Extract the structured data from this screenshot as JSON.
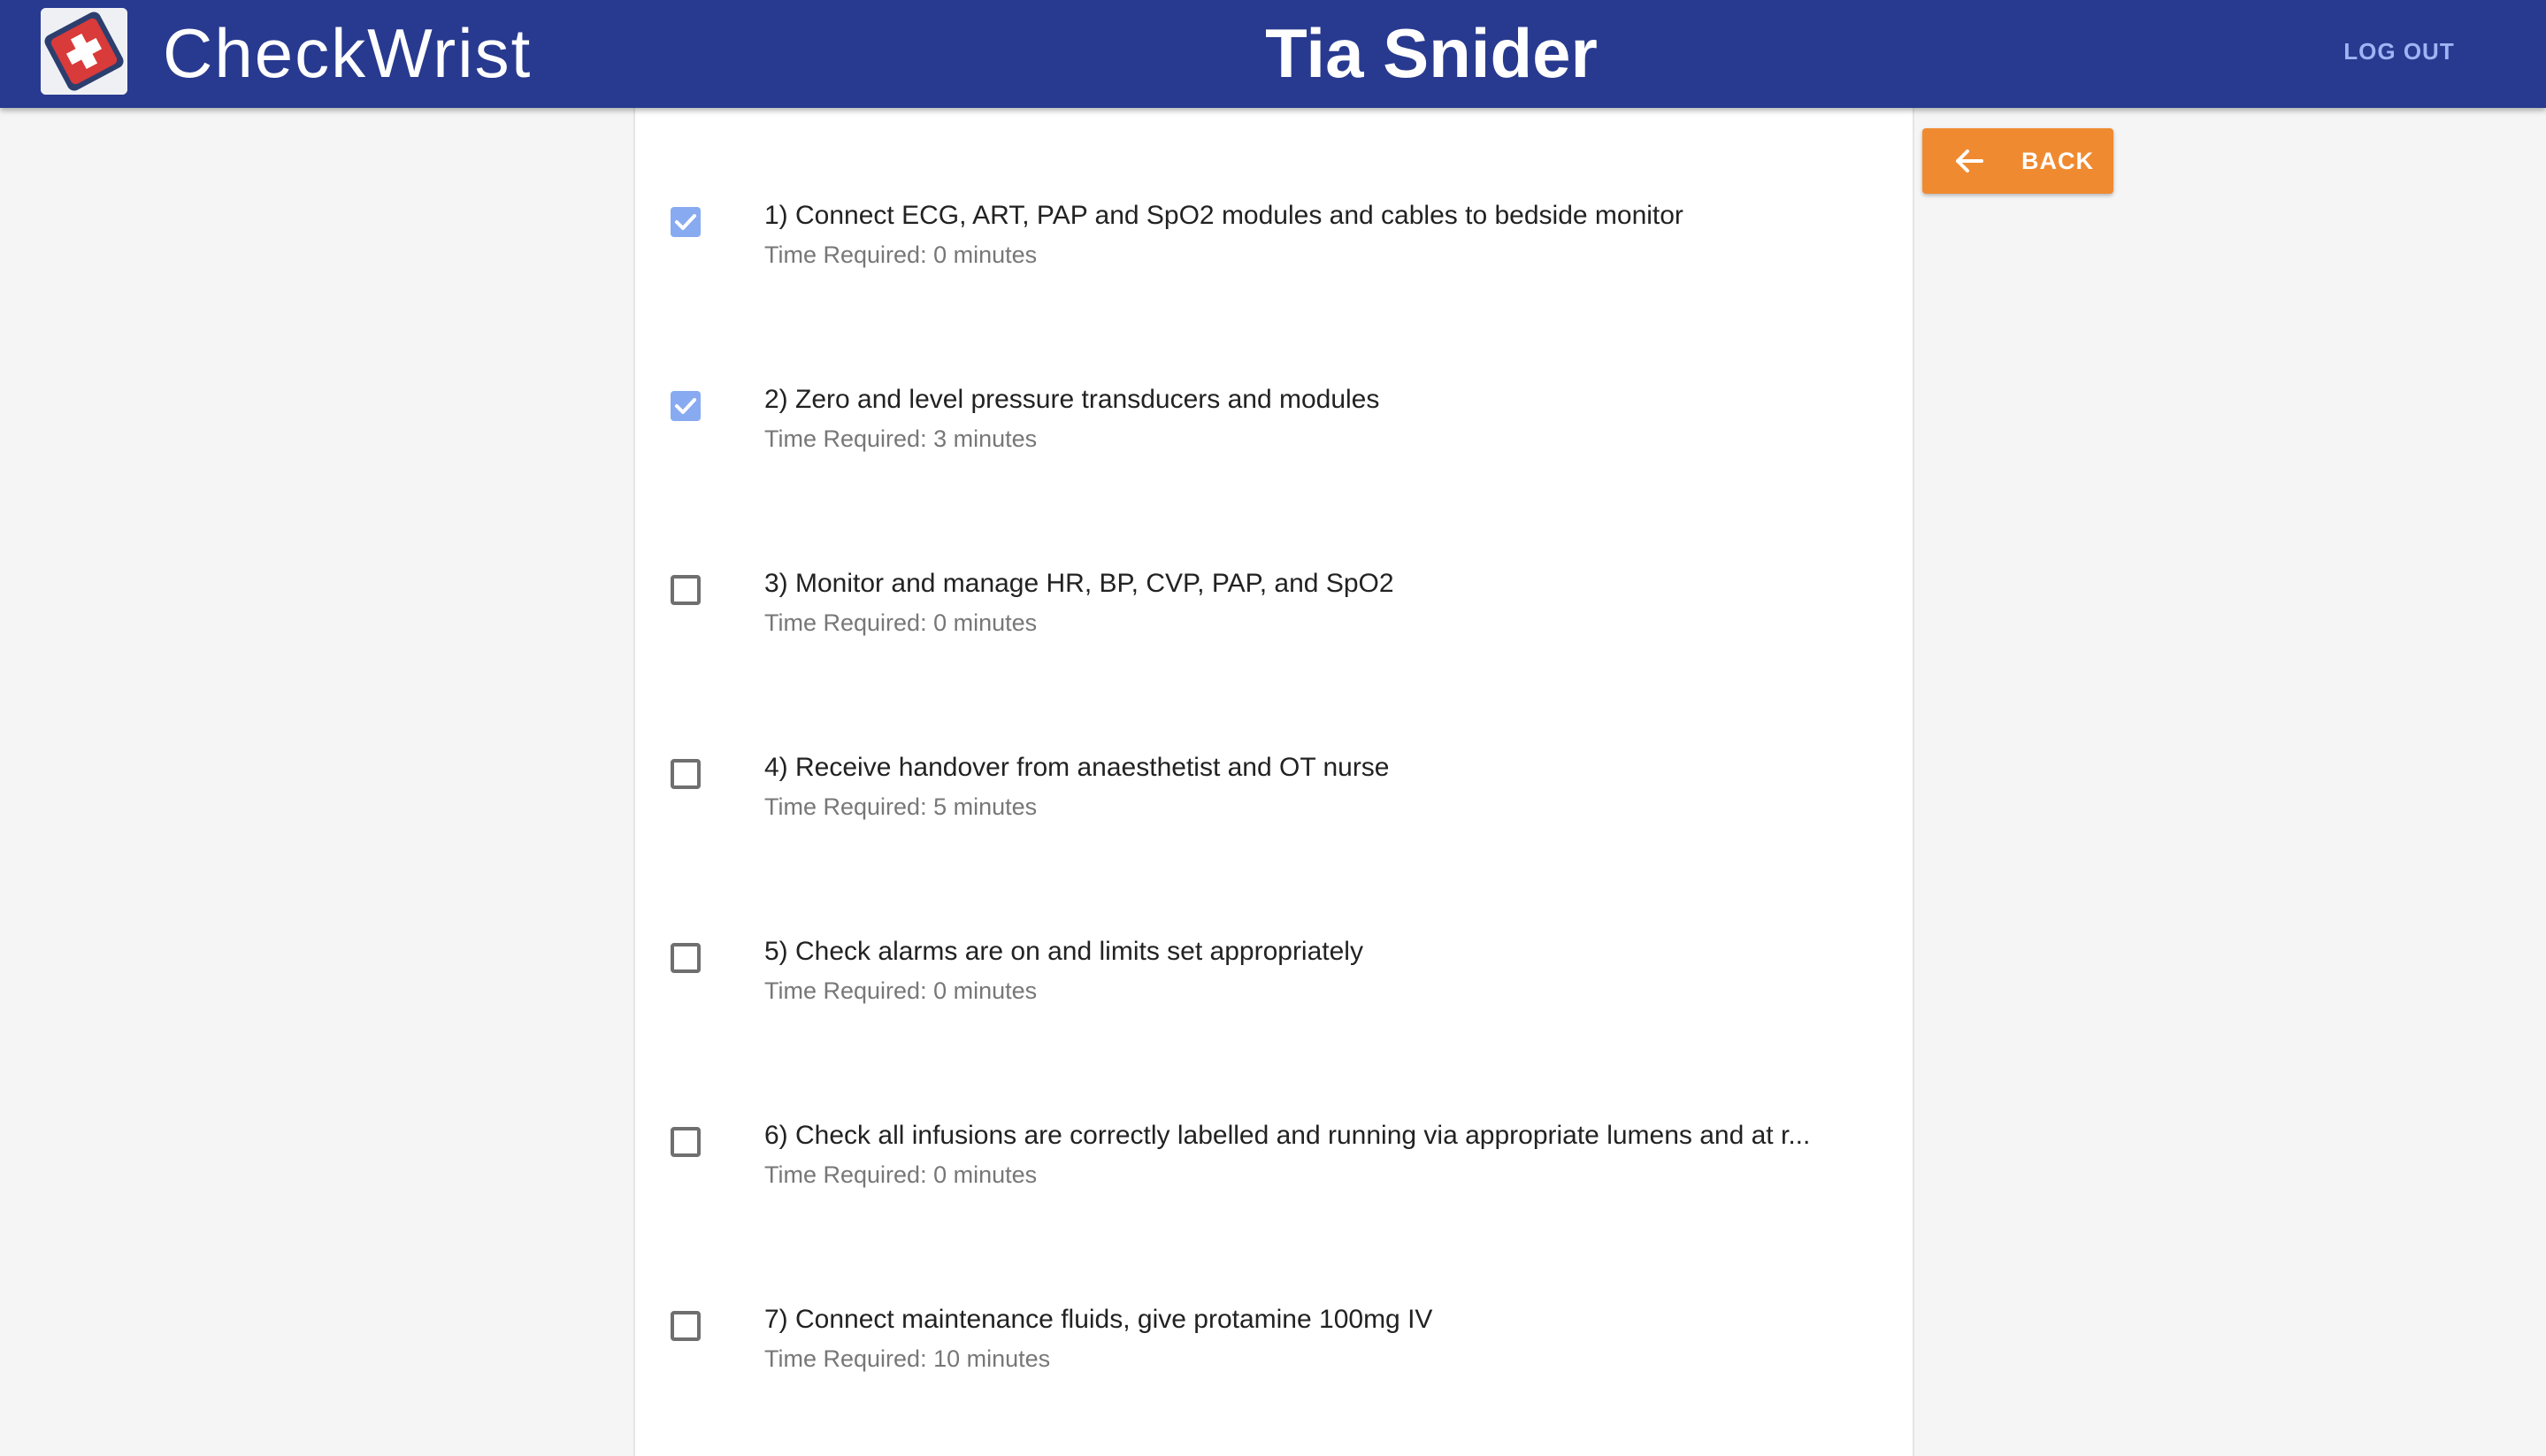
{
  "app": {
    "brand": "CheckWrist",
    "user_name": "Tia Snider",
    "logout_label": "LOG OUT"
  },
  "actions": {
    "back_label": "BACK"
  },
  "colors": {
    "appbar": "#283a8f",
    "back_button": "#f08a30",
    "checkbox_checked": "#88aaf0"
  },
  "tasks": [
    {
      "title": "1) Connect ECG, ART, PAP and SpO2 modules and cables to bedside monitor",
      "time": "Time Required: 0 minutes",
      "checked": true
    },
    {
      "title": "2) Zero and level pressure transducers and modules",
      "time": "Time Required: 3 minutes",
      "checked": true
    },
    {
      "title": "3) Monitor and manage HR, BP, CVP, PAP, and SpO2",
      "time": "Time Required: 0 minutes",
      "checked": false
    },
    {
      "title": "4) Receive handover from anaesthetist and OT nurse",
      "time": "Time Required: 5 minutes",
      "checked": false
    },
    {
      "title": "5) Check alarms are on and limits set appropriately",
      "time": "Time Required: 0 minutes",
      "checked": false
    },
    {
      "title": "6) Check all infusions are correctly labelled and running via appropriate lumens and at r...",
      "time": "Time Required: 0 minutes",
      "checked": false
    },
    {
      "title": "7) Connect maintenance fluids, give protamine 100mg IV",
      "time": "Time Required: 10 minutes",
      "checked": false
    }
  ]
}
